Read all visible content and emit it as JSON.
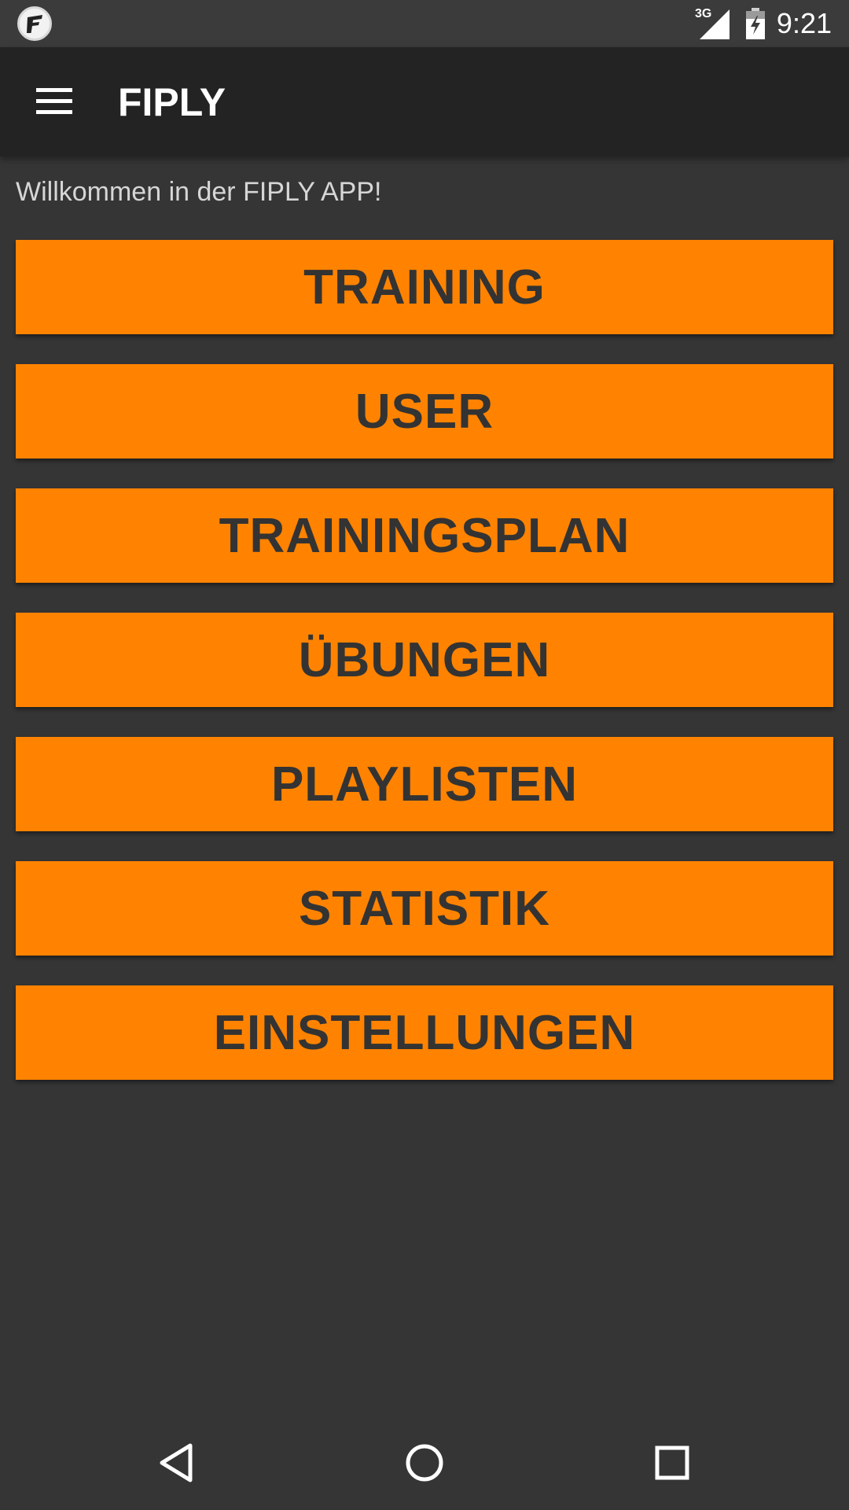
{
  "status_bar": {
    "network_label": "3G",
    "time": "9:21",
    "app_icon": "fiply-app-icon",
    "signal_icon": "signal-icon",
    "battery_icon": "battery-charging-icon"
  },
  "toolbar": {
    "title": "FIPLY",
    "menu_icon": "hamburger-menu-icon"
  },
  "content": {
    "welcome": "Willkommen in der FIPLY APP!",
    "buttons": [
      {
        "label": "TRAINING"
      },
      {
        "label": "USER"
      },
      {
        "label": "TRAININGSPLAN"
      },
      {
        "label": "ÜBUNGEN"
      },
      {
        "label": "PLAYLISTEN"
      },
      {
        "label": "STATISTIK"
      },
      {
        "label": "EINSTELLUNGEN"
      }
    ]
  },
  "nav_bar": {
    "back_icon": "back-triangle-icon",
    "home_icon": "home-circle-icon",
    "recents_icon": "recents-square-icon"
  },
  "colors": {
    "background": "#353535",
    "toolbar": "#232323",
    "accent": "#ff8300",
    "button_text": "#333333"
  }
}
